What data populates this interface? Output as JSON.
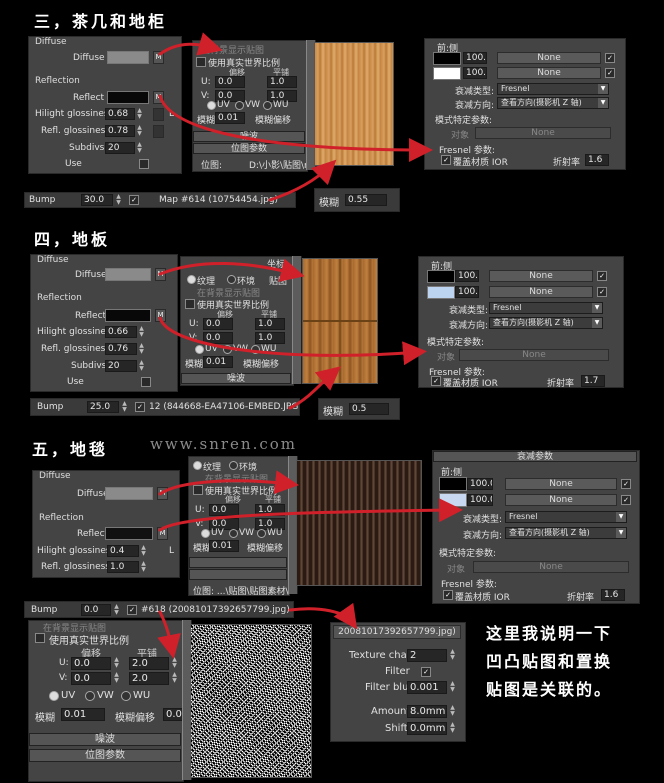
{
  "sections": {
    "s3_title": "三，茶几和地柜",
    "s4_title": "四，地板",
    "s5_title": "五，地毯"
  },
  "watermark": "www.snren.com",
  "note": [
    "这里我说明一下",
    "凹凸贴图和置换",
    "贴图是关联的。"
  ],
  "common": {
    "diffuse_group": "Diffuse",
    "diffuse_label": "Diffuse",
    "reflection_group": "Reflection",
    "reflect_label": "Reflect",
    "hilight_label": "Hilight glossiness",
    "refl_label": "Refl. glossiness",
    "subdivs_label": "Subdivs",
    "use_label": "Use",
    "map_btn": "M",
    "lock_btn": "L",
    "bump_label": "Bump",
    "texture_label": "纹理",
    "env_label": "环境",
    "sticker_label": "贴图",
    "show_bg": "在背景显示贴图",
    "real_world": "使用真实世界比例",
    "offset_label": "偏移",
    "tiling_label": "平铺",
    "u_label": "U:",
    "v_label": "V:",
    "uv": "UV",
    "vw": "VW",
    "wu": "WU",
    "blur_label": "模糊",
    "blur_offset_label": "模糊偏移",
    "noise_rollout": "噪波",
    "bitmap_rollout": "位图参数",
    "bitmap_label": "位图:",
    "falloff_rollout": "衰减参数",
    "front_side": "前:侧",
    "none": "None",
    "falloff_type_label": "衰减类型:",
    "falloff_type": "Fresnel",
    "falloff_dir_label": "衰减方向:",
    "falloff_dir": "查看方向(摄影机 Z 轴)",
    "mode_params": "模式特定参数:",
    "object_label": "对象",
    "fresnel_params": "Fresnel 参数:",
    "override_ior": "覆盖材质 IOR",
    "ior_label": "折射率",
    "value_100": "100.0",
    "mapping_label": "坐标"
  },
  "s3": {
    "hilight": "0.68",
    "refl": "0.78",
    "subdivs": "20",
    "bump_amount": "30.0",
    "bump_map": "Map #614 (10754454.jpg)",
    "u_off": "0.0",
    "v_off": "0.0",
    "u_tile": "1.0",
    "v_tile": "1.0",
    "blur": "0.01",
    "bitmap_path": "D:\\小影\\贴图\\ma...",
    "zoom_blur": "0.55",
    "ior": "1.6"
  },
  "s4": {
    "hilight": "0.66",
    "refl": "0.76",
    "subdivs": "20",
    "bump_amount": "25.0",
    "bump_map": "12 (844668-EA47106-EMBED.JPG)",
    "u_off": "0.0",
    "v_off": "0.0",
    "u_tile": "1.0",
    "v_tile": "1.0",
    "blur": "0.01",
    "zoom_blur": "0.5",
    "ior": "1.7"
  },
  "s5": {
    "hilight": "0.4",
    "refl": "1.0",
    "bump_amount": "0.0",
    "bump_map": "#618  (20081017392657799.jpg)",
    "u_off": "0.0",
    "v_off": "0.0",
    "u_tile": "1.0",
    "v_tile": "1.0",
    "blur": "0.01",
    "bitmap_path": "位图:   ...\\贴图\\贴图素材\\20...",
    "ior": "1.6"
  },
  "s5b": {
    "u_off": "0.0",
    "v_off": "0.0",
    "u_tile": "2.0",
    "v_tile": "2.0",
    "blur": "0.01",
    "blur_offset": "0.0",
    "map_name": "20081017392657799.jpg)",
    "texture_chan_label": "Texture chan",
    "texture_chan": "2",
    "filter_label": "Filter",
    "filter_blur_label": "Filter blur",
    "filter_blur": "0.001",
    "amount_label": "Amount",
    "amount": "8.0mm",
    "shift_label": "Shift",
    "shift": "0.0mm"
  },
  "colors": {
    "arrow": "#d0202a",
    "panel": "#444444"
  }
}
